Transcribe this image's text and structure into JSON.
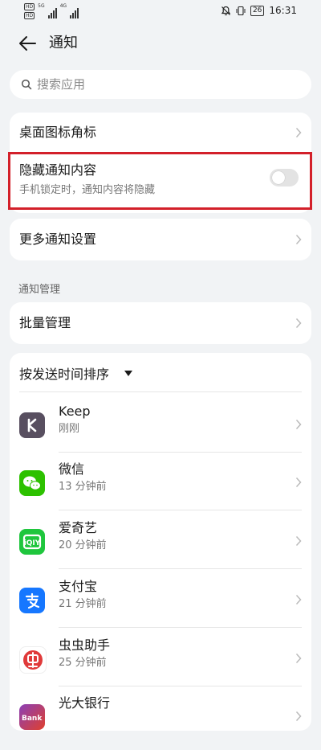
{
  "status_bar": {
    "hd_top": "HD",
    "hd_bottom": "HD",
    "net1": "5G",
    "net2": "4G",
    "battery": "26",
    "time": "16:31"
  },
  "header": {
    "title": "通知"
  },
  "search": {
    "placeholder": "搜索应用"
  },
  "settings": {
    "badge_label": "桌面图标角标",
    "hide_content_label": "隐藏通知内容",
    "hide_content_desc": "手机锁定时，通知内容将隐藏",
    "hide_content_enabled": false,
    "more_settings_label": "更多通知设置"
  },
  "management": {
    "section_title": "通知管理",
    "batch_label": "批量管理"
  },
  "app_list": {
    "sort_label": "按发送时间排序",
    "apps": [
      {
        "name": "Keep",
        "time": "刚刚",
        "icon": "keep-icon",
        "color": "#584f60"
      },
      {
        "name": "微信",
        "time": "13 分钟前",
        "icon": "wechat-icon",
        "color": "#2dc100"
      },
      {
        "name": "爱奇艺",
        "time": "20 分钟前",
        "icon": "iqiyi-icon",
        "color": "#1fc63d"
      },
      {
        "name": "支付宝",
        "time": "21 分钟前",
        "icon": "alipay-icon",
        "color": "#1677ff"
      },
      {
        "name": "虫虫助手",
        "time": "25 分钟前",
        "icon": "chongchong-icon",
        "color": "#e03a3a"
      },
      {
        "name": "光大银行",
        "time": "",
        "icon": "cebbank-icon",
        "color": "#7b3fa0"
      }
    ]
  },
  "colors": {
    "highlight": "#d3202a",
    "background": "#f1f3f5"
  }
}
